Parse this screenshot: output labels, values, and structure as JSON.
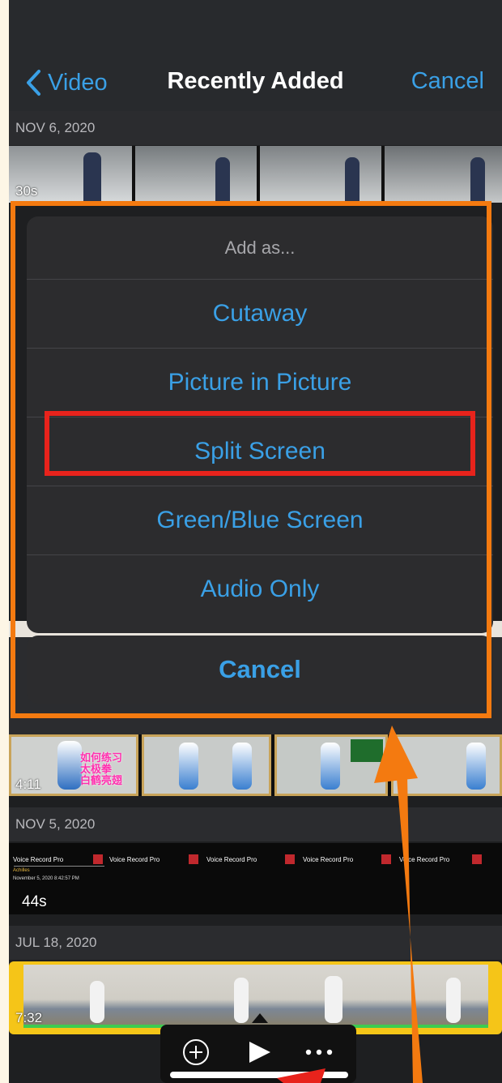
{
  "nav": {
    "back_label": "Video",
    "title": "Recently Added",
    "cancel_label": "Cancel"
  },
  "sections": [
    {
      "date": "NOV 6, 2020",
      "clips": [
        {
          "duration": "30s"
        },
        {
          "duration": "4:11"
        }
      ]
    },
    {
      "date": "NOV 5, 2020",
      "clips": [
        {
          "duration": "44s",
          "frame_title": "Voice Record Pro",
          "frame_sub": "Achilles",
          "frame_date": "November 5, 2020 8:42:57 PM"
        }
      ]
    },
    {
      "date": "JUL 18, 2020",
      "clips": [
        {
          "duration": "7:32"
        }
      ]
    }
  ],
  "tai_chi_caption": [
    "如何练习",
    "太极拳",
    "白鹤亮翅"
  ],
  "action_sheet": {
    "header": "Add as...",
    "options": [
      "Cutaway",
      "Picture in Picture",
      "Split Screen",
      "Green/Blue Screen",
      "Audio Only"
    ],
    "cancel": "Cancel",
    "highlighted_option": "Split Screen"
  },
  "toolbar": {
    "icons": [
      "add-circle-icon",
      "play-icon",
      "more-icon"
    ]
  },
  "colors": {
    "accent": "#3aa0e6",
    "annotation_orange": "#f47a10",
    "annotation_red": "#e8231c",
    "selection_yellow": "#f5c518"
  }
}
